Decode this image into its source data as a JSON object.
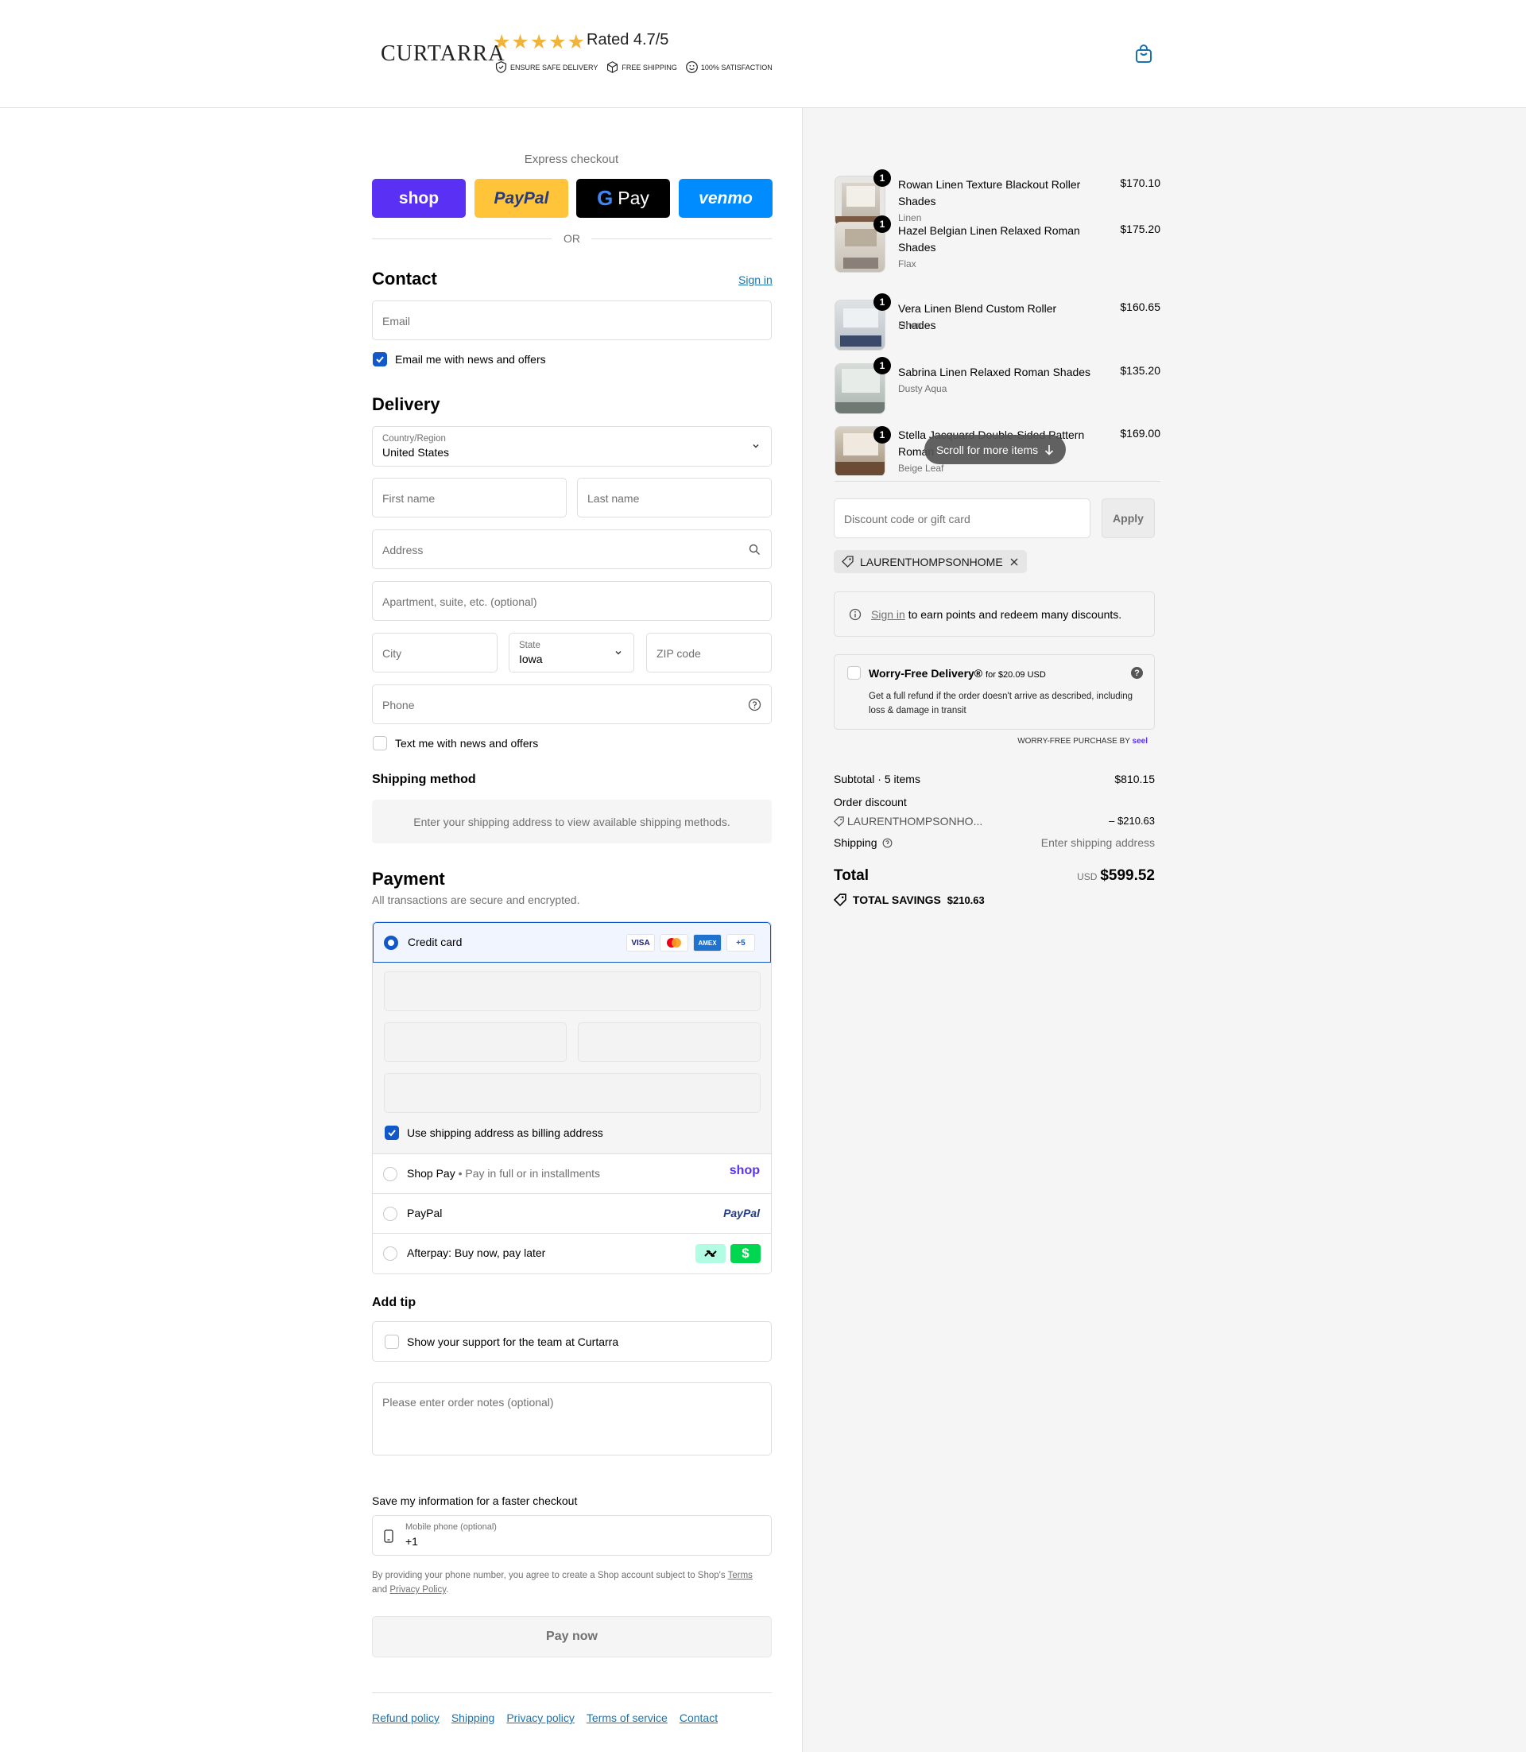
{
  "header": {
    "logo": "CURTARRA",
    "stars": "★★★★★",
    "rating": "Rated 4.7/5",
    "badges": [
      "ENSURE SAFE DELIVERY",
      "FREE SHIPPING",
      "100% SATISFACTION"
    ]
  },
  "express": {
    "title": "Express checkout",
    "buttons": [
      {
        "label": "shop",
        "color": "#5a31f4"
      },
      {
        "label": "PayPal",
        "color": "#ffc439"
      },
      {
        "label": "Pay",
        "color": "#000000"
      },
      {
        "label": "venmo",
        "color": "#008cff"
      }
    ],
    "or": "OR"
  },
  "contact": {
    "title": "Contact",
    "sign_in": "Sign in",
    "email_placeholder": "Email",
    "news_label": "Email me with news and offers"
  },
  "delivery": {
    "title": "Delivery",
    "country_label": "Country/Region",
    "country_value": "United States",
    "first_name": "First name",
    "last_name": "Last name",
    "address": "Address",
    "apartment": "Apartment, suite, etc. (optional)",
    "city": "City",
    "state_label": "State",
    "state_value": "Iowa",
    "zip": "ZIP code",
    "phone": "Phone",
    "text_label": "Text me with news and offers"
  },
  "shipping": {
    "title": "Shipping method",
    "message": "Enter your shipping address to view available shipping methods."
  },
  "payment": {
    "title": "Payment",
    "subtitle": "All transactions are secure and encrypted.",
    "credit_card": "Credit card",
    "card_logos": [
      "VISA",
      "MC",
      "AMEX",
      "+5"
    ],
    "billing_label": "Use shipping address as billing address",
    "shop_pay": "Shop Pay",
    "shop_pay_sub": "Pay in full or in installments",
    "shop_logo": "shop",
    "paypal": "PayPal",
    "paypal_logo": "PayPal",
    "afterpay": "Afterpay: Buy now, pay later"
  },
  "tip": {
    "title": "Add tip",
    "label": "Show your support for the team at Curtarra"
  },
  "notes": {
    "placeholder": "Please enter order notes (optional)"
  },
  "save": {
    "title": "Save my information for a faster checkout",
    "phone_label": "Mobile phone (optional)",
    "phone_value": "+1",
    "legal_1": "By providing your phone number, you agree to create a Shop account subject to Shop's",
    "terms": "Terms",
    "and": "and",
    "privacy": "Privacy Policy",
    "period": "."
  },
  "pay_now": "Pay now",
  "footer_links": [
    "Refund policy",
    "Shipping",
    "Privacy policy",
    "Terms of service",
    "Contact"
  ],
  "cart": {
    "items": [
      {
        "name": "Rowan Linen Texture Blackout Roller Shades",
        "variant": "Linen",
        "price": "$170.10",
        "qty": "1"
      },
      {
        "name": "Hazel Belgian Linen Relaxed Roman Shades",
        "variant": "Flax",
        "price": "$175.20",
        "qty": "1"
      },
      {
        "name": "Vera Linen Blend Custom Roller Shades",
        "variant": "Linen",
        "price": "$160.65",
        "qty": "1"
      },
      {
        "name": "Sabrina Linen Relaxed Roman Shades",
        "variant": "Dusty Aqua",
        "price": "$135.20",
        "qty": "1"
      },
      {
        "name": "Stella Jacquard Double-Sided Pattern Roman",
        "variant": "Beige Leaf",
        "price": "$169.00",
        "qty": "1"
      }
    ],
    "scroll_label": "Scroll for more items",
    "discount_placeholder": "Discount code or gift card",
    "apply": "Apply",
    "code": "LAURENTHOMPSONHOME",
    "points_link": "Sign in",
    "points_text": "to earn points and redeem many discounts.",
    "worry_title": "Worry-Free Delivery®",
    "worry_price": "for $20.09 USD",
    "worry_desc": "Get a full refund if the order doesn't arrive as described, including loss & damage in transit",
    "worry_by": "WORRY-FREE PURCHASE BY",
    "worry_brand": "seel",
    "subtotal_label": "Subtotal · 5 items",
    "subtotal": "$810.15",
    "order_discount": "Order discount",
    "discount_code_short": "LAURENTHOMPSONHO...",
    "discount_amount": "– $210.63",
    "shipping_label": "Shipping",
    "shipping_value": "Enter shipping address",
    "total_label": "Total",
    "currency": "USD",
    "total": "$599.52",
    "savings_label": "TOTAL SAVINGS",
    "savings": "$210.63"
  }
}
